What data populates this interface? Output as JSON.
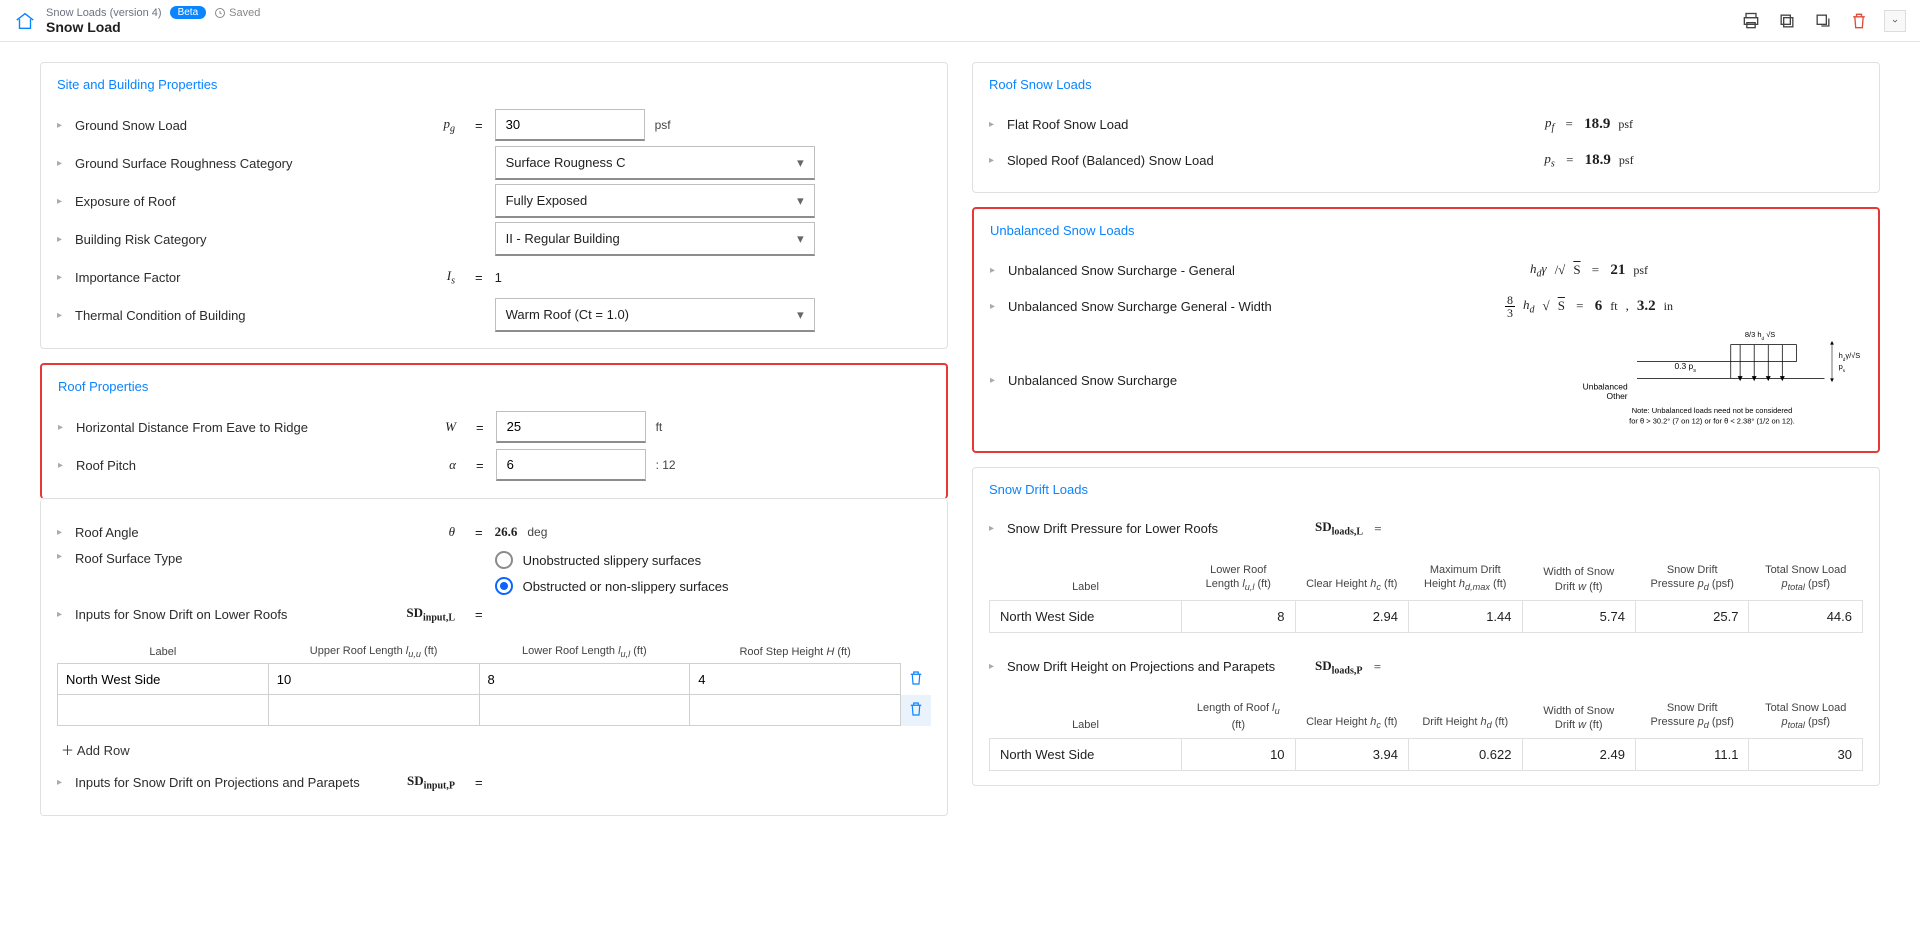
{
  "header": {
    "breadcrumb": "Snow Loads (version 4)",
    "badge": "Beta",
    "saved": "Saved",
    "title": "Snow Load"
  },
  "site": {
    "title": "Site and Building Properties",
    "groundSnowLoad": {
      "label": "Ground Snow Load",
      "sym": "p_g",
      "value": "30",
      "unit": "psf"
    },
    "roughness": {
      "label": "Ground Surface Roughness Category",
      "value": "Surface Rougness C"
    },
    "exposure": {
      "label": "Exposure of Roof",
      "value": "Fully Exposed"
    },
    "risk": {
      "label": "Building Risk Category",
      "value": "II - Regular Building"
    },
    "importance": {
      "label": "Importance Factor",
      "sym": "I_s",
      "value": "1"
    },
    "thermal": {
      "label": "Thermal Condition of Building",
      "value": "Warm Roof (Ct = 1.0)"
    }
  },
  "roof": {
    "title": "Roof Properties",
    "width": {
      "label": "Horizontal Distance From Eave to Ridge",
      "sym": "W",
      "value": "25",
      "unit": "ft"
    },
    "pitch": {
      "label": "Roof Pitch",
      "sym": "α",
      "value": "6",
      "unit": ": 12"
    },
    "angle": {
      "label": "Roof Angle",
      "sym": "θ",
      "value": "26.6",
      "unit": "deg"
    },
    "surfaceType": {
      "label": "Roof Surface Type",
      "opt1": "Unobstructed slippery surfaces",
      "opt2": "Obstructed or non-slippery surfaces"
    },
    "driftL": {
      "label": "Inputs for Snow Drift on Lower Roofs",
      "sym": "SD_input,L"
    },
    "driftTable": {
      "headers": [
        "Label",
        "Upper Roof Length l_u,u (ft)",
        "Lower Roof Length l_u,l (ft)",
        "Roof Step Height H (ft)"
      ],
      "rows": [
        {
          "label": "North West Side",
          "upper": "10",
          "lower": "8",
          "step": "4"
        }
      ],
      "addRow": "Add Row"
    },
    "driftP": {
      "label": "Inputs for Snow Drift on Projections and Parapets",
      "sym": "SD_input,P"
    }
  },
  "loads": {
    "title": "Roof Snow Loads",
    "flat": {
      "label": "Flat Roof Snow Load",
      "sym": "p_f",
      "value": "18.9",
      "unit": "psf"
    },
    "sloped": {
      "label": "Sloped Roof (Balanced) Snow Load",
      "sym": "p_s",
      "value": "18.9",
      "unit": "psf"
    }
  },
  "unbalanced": {
    "title": "Unbalanced Snow Loads",
    "surcharge": {
      "label": "Unbalanced Snow Surcharge - General",
      "expr": "h_dγ/√S",
      "value": "21",
      "unit": "psf"
    },
    "width": {
      "label": "Unbalanced Snow Surcharge General - Width",
      "value1": "6",
      "unit1": "ft",
      "value2": "3.2",
      "unit2": "in"
    },
    "diagram": {
      "label": "Unbalanced Snow Surcharge"
    },
    "diagramNote1": "Note: Unbalanced loads need not be considered",
    "diagramNote2": "for θ > 30.2° (7 on 12) or for θ < 2.38° (1/2 on 12).",
    "unbalancedLabel": "Unbalanced",
    "otherLabel": "Other"
  },
  "drift": {
    "title": "Snow Drift Loads",
    "lower": {
      "label": "Snow Drift Pressure for Lower Roofs",
      "sym": "SD_loads,L",
      "headers": [
        "Label",
        "Lower Roof Length l_u,l (ft)",
        "Clear Height h_c (ft)",
        "Maximum Drift Height h_d,max (ft)",
        "Width of Snow Drift w (ft)",
        "Snow Drift Pressure p_d (psf)",
        "Total Snow Load p_total (psf)"
      ],
      "rows": [
        {
          "label": "North West Side",
          "c1": "8",
          "c2": "2.94",
          "c3": "1.44",
          "c4": "5.74",
          "c5": "25.7",
          "c6": "44.6"
        }
      ]
    },
    "projections": {
      "label": "Snow Drift Height on Projections and Parapets",
      "sym": "SD_loads,P",
      "headers": [
        "Label",
        "Length of Roof l_u (ft)",
        "Clear Height h_c (ft)",
        "Drift Height h_d (ft)",
        "Width of Snow Drift w (ft)",
        "Snow Drift Pressure p_d (psf)",
        "Total Snow Load p_total (psf)"
      ],
      "rows": [
        {
          "label": "North West Side",
          "c1": "10",
          "c2": "3.94",
          "c3": "0.622",
          "c4": "2.49",
          "c5": "11.1",
          "c6": "30"
        }
      ]
    }
  }
}
